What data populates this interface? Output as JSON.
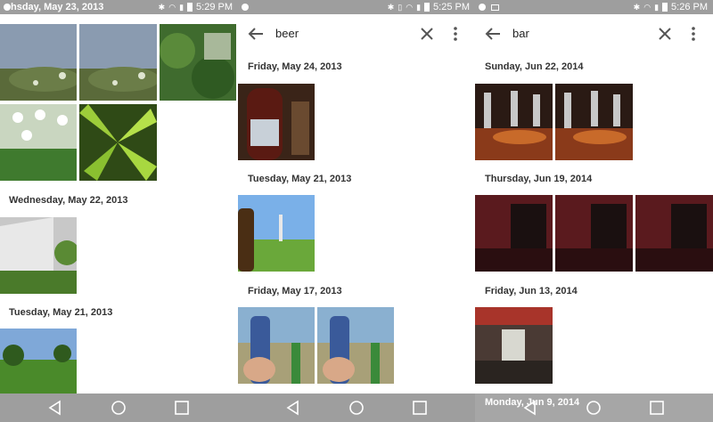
{
  "panel1": {
    "status_time": "5:29 PM",
    "top_date_partial": "hsday, May 23, 2013",
    "dates": [
      "Wednesday, May 22, 2013",
      "Tuesday, May 21, 2013"
    ]
  },
  "panel2": {
    "status_time": "5:25 PM",
    "query": "beer",
    "dates": [
      "Friday, May 24, 2013",
      "Tuesday, May 21, 2013",
      "Friday, May 17, 2013"
    ]
  },
  "panel3": {
    "status_time": "5:26 PM",
    "query": "bar",
    "dates": [
      "Sunday, Jun 22, 2014",
      "Thursday, Jun 19, 2014",
      "Friday, Jun 13, 2014",
      "Monday, Jun 9, 2014"
    ]
  },
  "colors": {
    "status_bar": "#9e9e9e",
    "nav_bar": "#9e9e9e"
  },
  "icons": {
    "back": "arrow-left-icon",
    "clear": "close-icon",
    "more": "more-vert-icon",
    "nav_back": "nav-back-icon",
    "nav_home": "nav-home-icon",
    "nav_recent": "nav-recent-icon"
  }
}
